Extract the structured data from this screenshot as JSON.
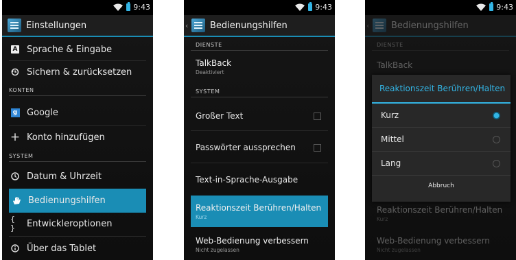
{
  "clock": "9:43",
  "colors": {
    "accent": "#33b5e5",
    "selected_bg": "#1a8db5"
  },
  "screen1": {
    "title": "Einstellungen",
    "items": [
      {
        "label": "Sprache & Eingabe",
        "icon": "keyboard-a-icon"
      },
      {
        "label": "Sichern & zurücksetzen",
        "icon": "restore-icon"
      },
      {
        "section": "KONTEN"
      },
      {
        "label": "Google",
        "icon": "google-icon"
      },
      {
        "label": "Konto hinzufügen",
        "icon": "plus-icon"
      },
      {
        "section": "SYSTEM"
      },
      {
        "label": "Datum & Uhrzeit",
        "icon": "clock-icon"
      },
      {
        "label": "Bedienungshilfen",
        "icon": "hand-icon",
        "selected": true
      },
      {
        "label": "Entwickleroptionen",
        "icon": "braces-icon"
      },
      {
        "label": "Über das Tablet",
        "icon": "info-icon"
      }
    ]
  },
  "screen2": {
    "title": "Bedienungshilfen",
    "section_services": "DIENSTE",
    "talkback_title": "TalkBack",
    "talkback_summary": "Deaktiviert",
    "section_system": "SYSTEM",
    "large_text": "Großer Text",
    "speak_passwords": "Passwörter aussprechen",
    "tts_output": "Text-in-Sprache-Ausgabe",
    "touch_hold_title": "Reaktionszeit Berühren/Halten",
    "touch_hold_summary": "Kurz",
    "web_title": "Web-Bedienung verbessern",
    "web_summary": "Nicht zugelassen"
  },
  "screen3": {
    "title": "Bedienungshilfen",
    "section_services": "DIENSTE",
    "talkback_title": "TalkBack",
    "dialog_title": "Reaktionszeit Berühren/Halten",
    "options": [
      "Kurz",
      "Mittel",
      "Lang"
    ],
    "selected_option": "Kurz",
    "cancel": "Abbruch",
    "touch_hold_title": "Reaktionszeit Berühren/Halten",
    "touch_hold_summary": "Kurz",
    "web_title": "Web-Bedienung verbessern",
    "web_summary": "Nicht zugelassen"
  }
}
